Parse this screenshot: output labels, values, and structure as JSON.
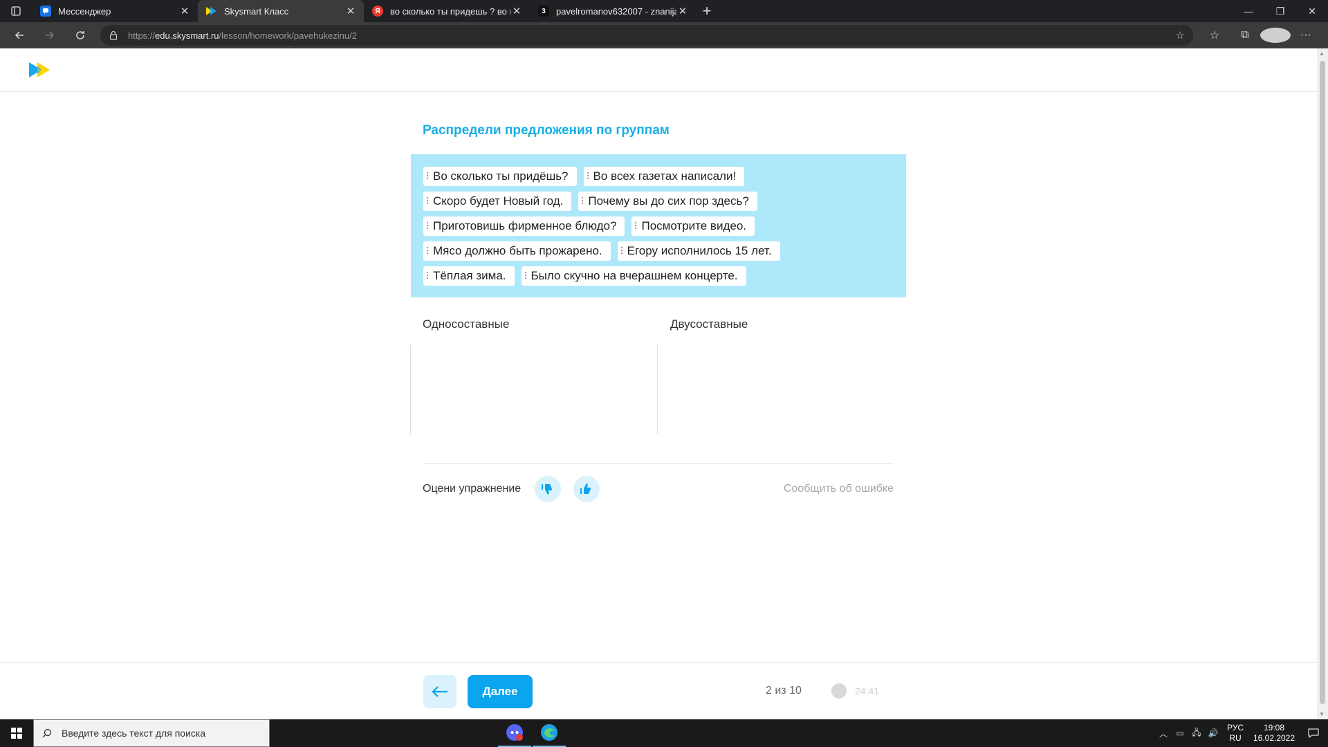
{
  "browser": {
    "tabs": [
      {
        "title": "Мессенджер",
        "favicon_color": "#1a73e8",
        "active": false
      },
      {
        "title": "Skysmart Класс",
        "favicon_color": "#ffd400",
        "active": true
      },
      {
        "title": "во сколько ты придешь ? во вс",
        "favicon_color": "#ea3b2e",
        "favicon_letter": "Я",
        "active": false
      },
      {
        "title": "pavelromanov632007 - znanija.c",
        "favicon_color": "#111111",
        "favicon_letter": "3",
        "active": false
      }
    ],
    "url_prefix": "https://",
    "url_host": "edu.skysmart.ru",
    "url_path": "/lesson/homework/pavehukezinu/2"
  },
  "task": {
    "title": "Распредели предложения по группам",
    "rows": [
      [
        "Во сколько ты придёшь?",
        "Во всех газетах написали!"
      ],
      [
        "Скоро будет Новый год.",
        "Почему вы до сих пор здесь?"
      ],
      [
        "Приготовишь фирменное блюдо?",
        "Посмотрите видео."
      ],
      [
        "Мясо должно быть прожарено.",
        "Егору исполнилось 15 лет."
      ],
      [
        "Тёплая зима.",
        "Было скучно на вчерашнем концерте."
      ]
    ],
    "groups": {
      "left": "Односоставные",
      "right": "Двусоставные"
    }
  },
  "rating": {
    "label": "Оцени упражнение",
    "report": "Сообщить об ошибке"
  },
  "footer": {
    "next_label": "Далее",
    "progress": "2 из 10",
    "timer": "24:41"
  },
  "taskbar": {
    "search_placeholder": "Введите здесь текст для поиска",
    "lang_top": "РУС",
    "lang_bottom": "RU",
    "time": "19:08",
    "date": "16.02.2022"
  },
  "colors": {
    "accent": "#0aa4ef",
    "title": "#17aee5",
    "pool_bg": "#aee8fb"
  }
}
